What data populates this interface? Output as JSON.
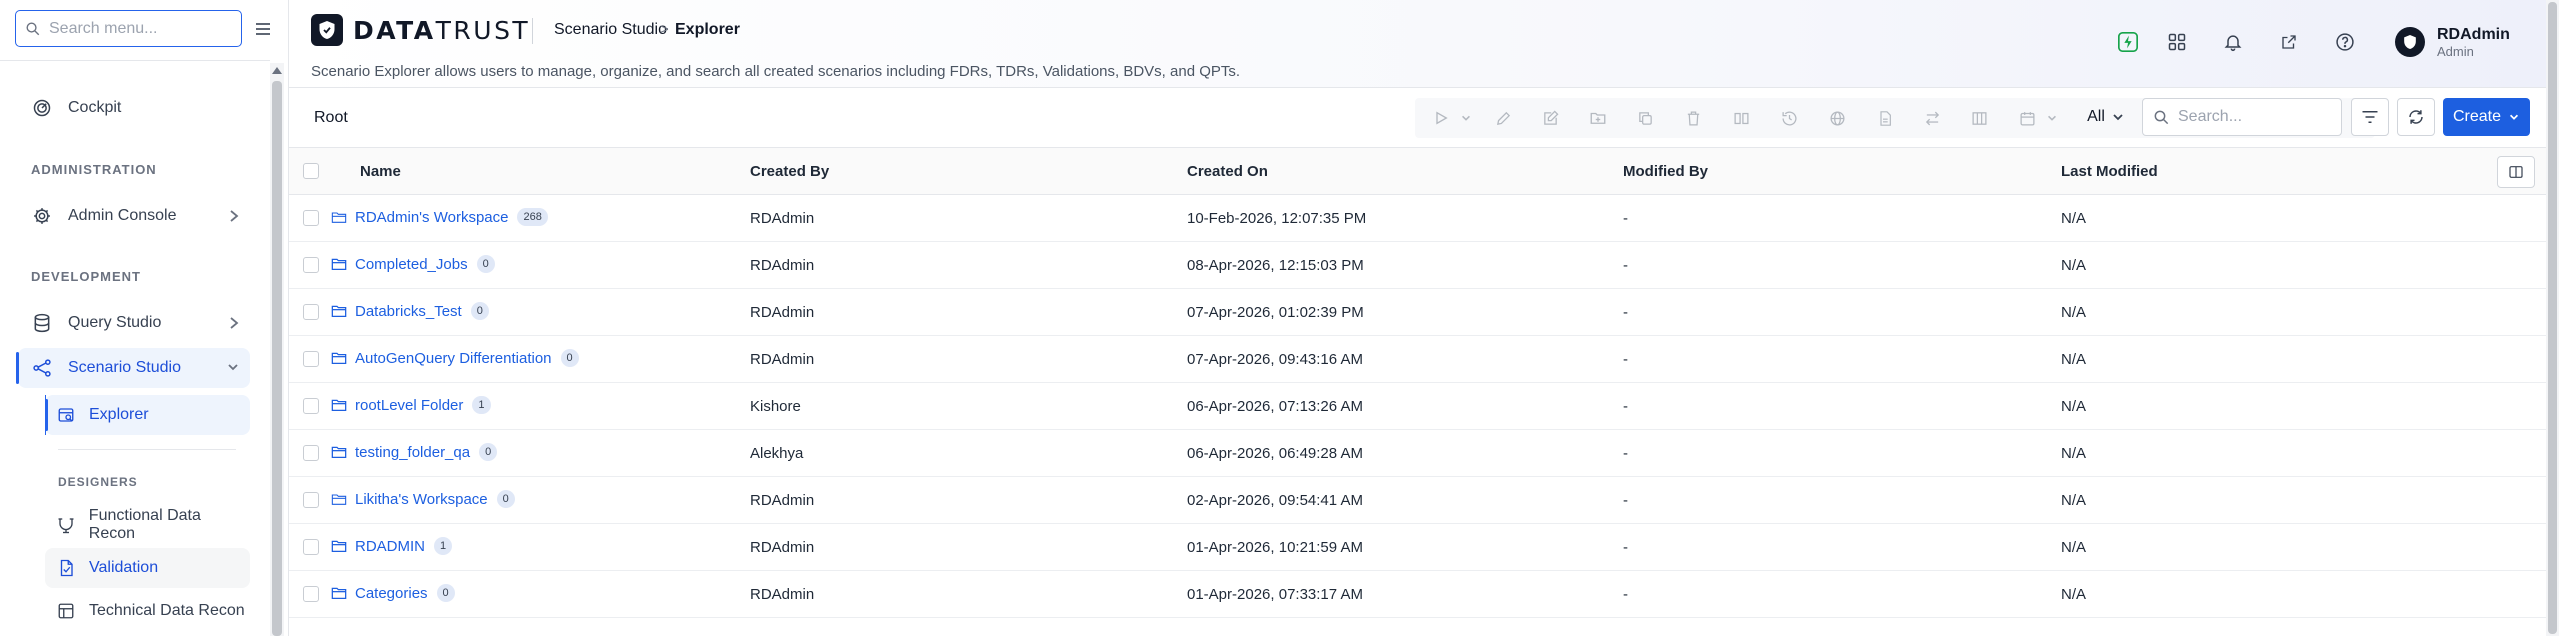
{
  "sidebar": {
    "search_placeholder": "Search menu...",
    "items": {
      "cockpit": "Cockpit",
      "admin_console": "Admin Console",
      "query_studio": "Query Studio",
      "scenario_studio": "Scenario Studio",
      "explorer": "Explorer",
      "functional_data_recon": "Functional Data Recon",
      "validation": "Validation",
      "technical_data_recon": "Technical Data Recon"
    },
    "sections": {
      "administration": "ADMINISTRATION",
      "development": "DEVELOPMENT",
      "designers": "DESIGNERS"
    }
  },
  "header": {
    "logo_bold": "DATA",
    "logo_light": "TRUST",
    "breadcrumb": [
      "Scenario Studio",
      "Explorer"
    ],
    "breadcrumb_separator": ">",
    "description": "Scenario Explorer allows users to manage, organize, and search all created scenarios including FDRs, TDRs, Validations, BDVs, and QPTs.",
    "user": {
      "name": "RDAdmin",
      "role": "Admin"
    }
  },
  "toolbar": {
    "root_label": "Root",
    "filter_value": "All",
    "search_placeholder": "Search...",
    "create_label": "Create"
  },
  "table": {
    "columns": [
      "Name",
      "Created By",
      "Created On",
      "Modified By",
      "Last Modified"
    ],
    "rows": [
      {
        "name": "RDAdmin's Workspace",
        "count": "268",
        "created_by": "RDAdmin",
        "created_on": "10-Feb-2026, 12:07:35 PM",
        "modified_by": "-",
        "last_modified": "N/A",
        "workspace": true
      },
      {
        "name": "Completed_Jobs",
        "count": "0",
        "created_by": "RDAdmin",
        "created_on": "08-Apr-2026, 12:15:03 PM",
        "modified_by": "-",
        "last_modified": "N/A",
        "workspace": false
      },
      {
        "name": "Databricks_Test",
        "count": "0",
        "created_by": "RDAdmin",
        "created_on": "07-Apr-2026, 01:02:39 PM",
        "modified_by": "-",
        "last_modified": "N/A",
        "workspace": false
      },
      {
        "name": "AutoGenQuery Differentiation",
        "count": "0",
        "created_by": "RDAdmin",
        "created_on": "07-Apr-2026, 09:43:16 AM",
        "modified_by": "-",
        "last_modified": "N/A",
        "workspace": false
      },
      {
        "name": "rootLevel Folder",
        "count": "1",
        "created_by": "Kishore",
        "created_on": "06-Apr-2026, 07:13:26 AM",
        "modified_by": "-",
        "last_modified": "N/A",
        "workspace": false
      },
      {
        "name": "testing_folder_qa",
        "count": "0",
        "created_by": "Alekhya",
        "created_on": "06-Apr-2026, 06:49:28 AM",
        "modified_by": "-",
        "last_modified": "N/A",
        "workspace": false
      },
      {
        "name": "Likitha's Workspace",
        "count": "0",
        "created_by": "RDAdmin",
        "created_on": "02-Apr-2026, 09:54:41 AM",
        "modified_by": "-",
        "last_modified": "N/A",
        "workspace": true
      },
      {
        "name": "RDADMIN",
        "count": "1",
        "created_by": "RDAdmin",
        "created_on": "01-Apr-2026, 10:21:59 AM",
        "modified_by": "-",
        "last_modified": "N/A",
        "workspace": false
      },
      {
        "name": "Categories",
        "count": "0",
        "created_by": "RDAdmin",
        "created_on": "01-Apr-2026, 07:33:17 AM",
        "modified_by": "-",
        "last_modified": "N/A",
        "workspace": false
      }
    ]
  },
  "colors": {
    "accent": "#1d5fe0",
    "active_bg": "#eef4fd",
    "badge_bg": "#e0e8f7",
    "notification_green": "#16a34a"
  },
  "icons": {
    "sidebar": [
      "search-icon",
      "menu-icon",
      "cockpit-icon",
      "gear-icon",
      "database-icon",
      "share-nodes-icon",
      "explorer-icon",
      "recon-icon",
      "validation-doc-icon",
      "technical-recon-icon"
    ],
    "header": [
      "shield-icon",
      "bolt-icon",
      "grid-icon",
      "bell-icon",
      "external-link-icon",
      "help-icon"
    ],
    "toolbar": [
      "play-icon",
      "pencil-icon",
      "edit-icon",
      "folder-plus-icon",
      "copy-icon",
      "trash-icon",
      "split-icon",
      "history-icon",
      "globe-icon",
      "document-icon",
      "transfer-icon",
      "columns-icon",
      "calendar-icon",
      "filter-icon",
      "refresh-icon",
      "chevron-down-icon"
    ]
  }
}
